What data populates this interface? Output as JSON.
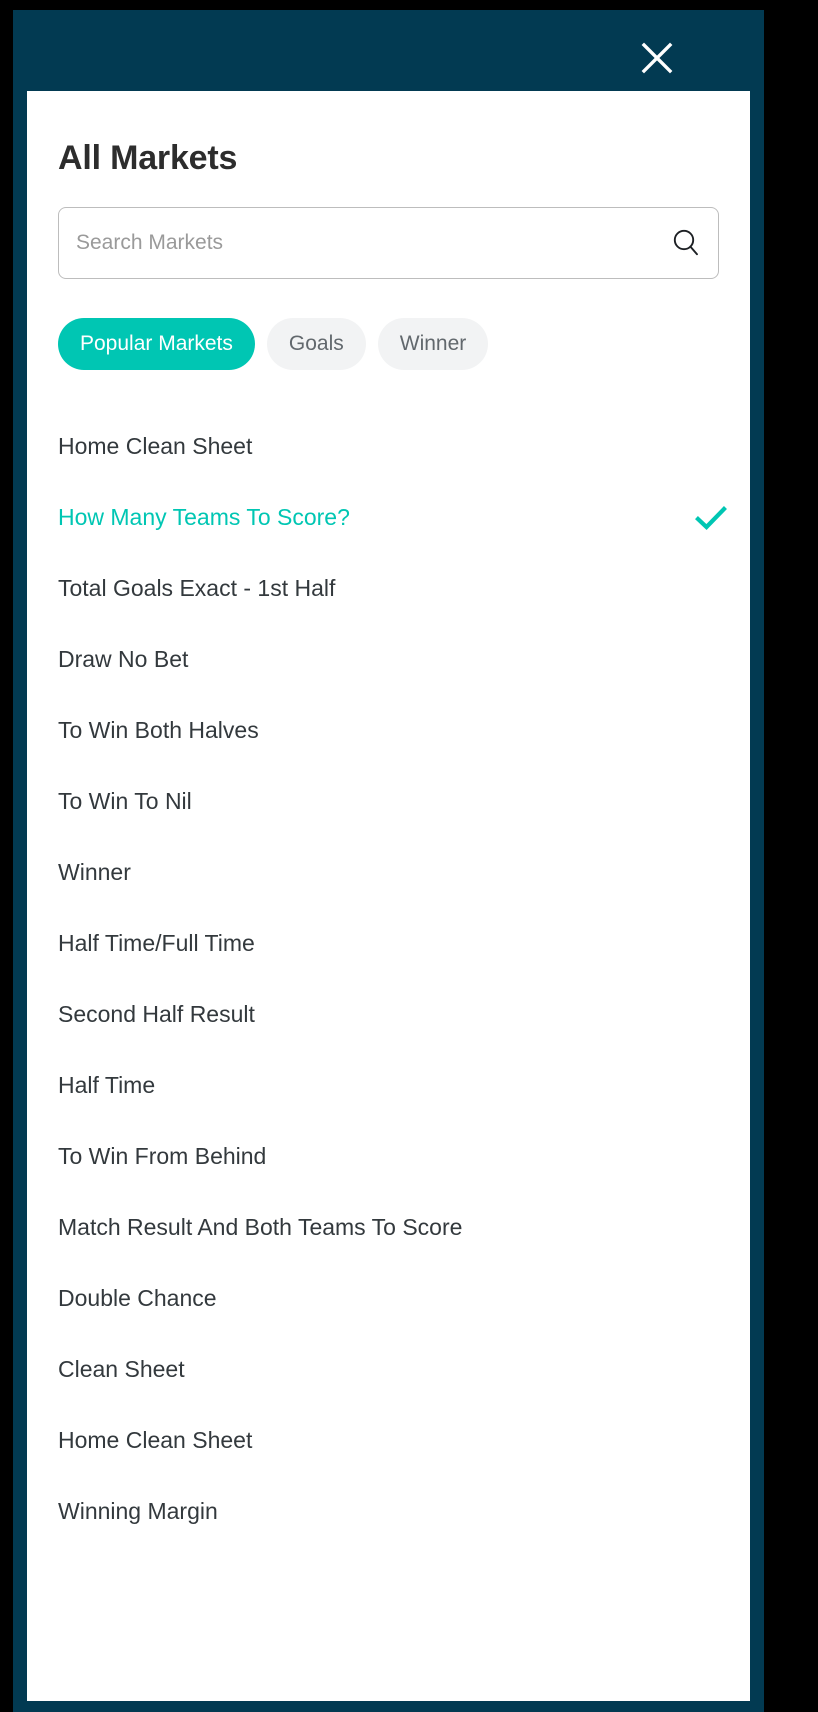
{
  "colors": {
    "header_navy": "#023a52",
    "accent_teal": "#00c6b3",
    "pill_inactive_bg": "#f2f3f4",
    "text_dark": "#33393d",
    "placeholder": "#9a9a9a",
    "sheet_bg": "#ffffff",
    "backdrop": "#000000"
  },
  "header": {
    "close_label": "close-icon"
  },
  "title": "All Markets",
  "search": {
    "placeholder": "Search Markets",
    "value": "",
    "icon": "search-icon"
  },
  "filters": [
    {
      "label": "Popular Markets",
      "active": true
    },
    {
      "label": "Goals",
      "active": false
    },
    {
      "label": "Winner",
      "active": false
    }
  ],
  "markets": [
    {
      "label": "Home Clean Sheet",
      "selected": false
    },
    {
      "label": "How Many Teams To Score?",
      "selected": true
    },
    {
      "label": "Total Goals Exact - 1st Half",
      "selected": false
    },
    {
      "label": "Draw No Bet",
      "selected": false
    },
    {
      "label": "To Win Both Halves",
      "selected": false
    },
    {
      "label": "To Win To Nil",
      "selected": false
    },
    {
      "label": "Winner",
      "selected": false
    },
    {
      "label": "Half Time/Full Time",
      "selected": false
    },
    {
      "label": "Second Half Result",
      "selected": false
    },
    {
      "label": "Half Time",
      "selected": false
    },
    {
      "label": "To Win From Behind",
      "selected": false
    },
    {
      "label": "Match Result And Both Teams To Score",
      "selected": false
    },
    {
      "label": "Double Chance",
      "selected": false
    },
    {
      "label": "Clean Sheet",
      "selected": false
    },
    {
      "label": "Home Clean Sheet",
      "selected": false
    },
    {
      "label": "Winning Margin",
      "selected": false
    }
  ],
  "selected_market": "How Many Teams To Score?",
  "selected_market_check": "check-icon"
}
